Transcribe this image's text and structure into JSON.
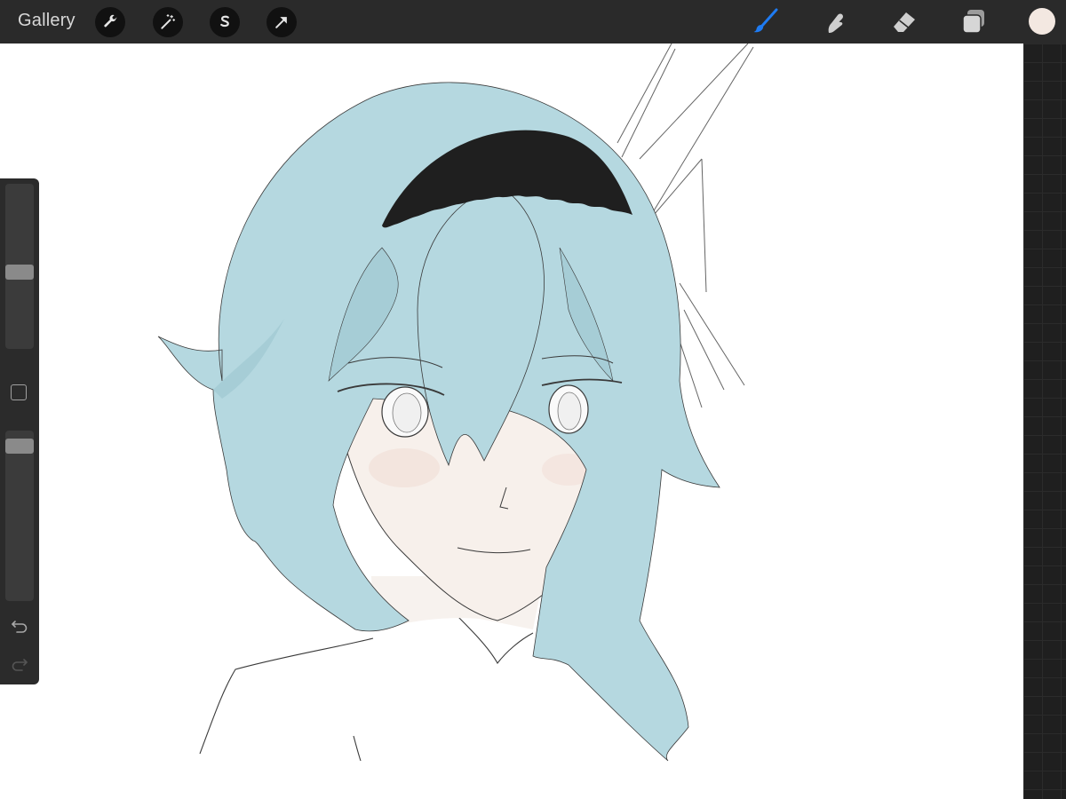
{
  "app": {
    "gallery_label": "Gallery"
  },
  "toolbar": {
    "left_tools": [
      "wrench-icon",
      "magic-wand-icon",
      "selection-s-icon",
      "transform-arrow-icon"
    ],
    "right_tools": [
      "brush-icon",
      "smudge-icon",
      "eraser-icon",
      "layers-icon"
    ],
    "active_tool": "brush-icon",
    "active_color": "#f3e8e1"
  },
  "sidebar": {
    "brush_size_level": 0.46,
    "opacity_level": 0.95,
    "controls": [
      "brush-size-slider",
      "modify-button",
      "opacity-slider",
      "undo-icon",
      "redo-icon"
    ]
  },
  "colors": {
    "hair": "#b5d8e0",
    "hair_shadow": "#a6cdd6",
    "headband": "#1f1f1f",
    "skin": "#f6efea",
    "line": "#3a3a3a",
    "accent_brush": "#1e7bf2"
  }
}
